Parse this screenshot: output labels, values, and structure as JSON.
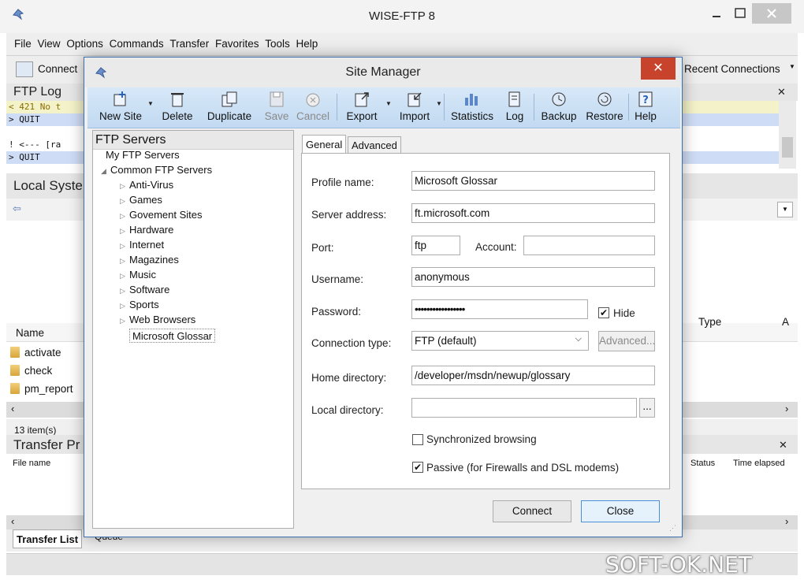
{
  "app": {
    "title": "WISE-FTP 8",
    "menu": [
      "File",
      "View",
      "Options",
      "Commands",
      "Transfer",
      "Favorites",
      "Tools",
      "Help"
    ],
    "connect_label": "Connect",
    "recent_label": "Recent Connections",
    "ftp_log_title": "FTP Log",
    "log_lines": [
      "< 421 No t",
      "> QUIT",
      "",
      "! <--- [ra",
      "> QUIT"
    ],
    "local_system_title": "Local Syste",
    "name_header": "Name",
    "type_header": "Type",
    "a_header": "A",
    "files": [
      "activate",
      "check",
      "pm_report"
    ],
    "items_count": "13 item(s)",
    "transfer_title": "Transfer Pr",
    "file_name_header": "File name",
    "status_header": "Status",
    "time_elapsed_header": "Time elapsed",
    "transfer_tabs": [
      "Transfer List",
      "Queue"
    ],
    "watermark": "SOFT-OK.NET"
  },
  "dialog": {
    "title": "Site Manager",
    "toolbar": [
      {
        "label": "New Site",
        "icon": "new-site-icon"
      },
      {
        "label": "Delete",
        "icon": "trash-icon"
      },
      {
        "label": "Duplicate",
        "icon": "duplicate-icon"
      },
      {
        "label": "Save",
        "icon": "save-icon"
      },
      {
        "label": "Cancel",
        "icon": "cancel-icon"
      },
      {
        "label": "Export",
        "icon": "export-icon"
      },
      {
        "label": "Import",
        "icon": "import-icon"
      },
      {
        "label": "Statistics",
        "icon": "statistics-icon"
      },
      {
        "label": "Log",
        "icon": "log-icon"
      },
      {
        "label": "Backup",
        "icon": "backup-icon"
      },
      {
        "label": "Restore",
        "icon": "restore-icon"
      },
      {
        "label": "Help",
        "icon": "help-icon"
      }
    ],
    "tree_title": "FTP Servers",
    "tree": {
      "my_servers": "My FTP Servers",
      "common_servers": "Common FTP Servers",
      "categories": [
        "Anti-Virus",
        "Games",
        "Govement Sites",
        "Hardware",
        "Internet",
        "Magazines",
        "Music",
        "Software",
        "Sports",
        "Web Browsers"
      ],
      "selected": "Microsoft Glossar"
    },
    "tabs": [
      "General",
      "Advanced"
    ],
    "form": {
      "profile_name_label": "Profile name:",
      "profile_name": "Microsoft Glossar",
      "server_address_label": "Server address:",
      "server_address": "ft.microsoft.com",
      "port_label": "Port:",
      "port": "ftp",
      "account_label": "Account:",
      "account": "",
      "username_label": "Username:",
      "username": "anonymous",
      "password_label": "Password:",
      "password": "•••••••••••••••••",
      "hide_label": "Hide",
      "hide_checked": true,
      "connection_type_label": "Connection type:",
      "connection_type": "FTP (default)",
      "advanced_button": "Advanced...",
      "home_dir_label": "Home directory:",
      "home_dir": "/developer/msdn/newup/glossary",
      "local_dir_label": "Local directory:",
      "local_dir": "",
      "browse_button": "...",
      "sync_label": "Synchronized browsing",
      "sync_checked": false,
      "passive_label": "Passive (for Firewalls and DSL modems)",
      "passive_checked": true
    },
    "connect_button": "Connect",
    "close_button": "Close"
  },
  "colors": {
    "accent": "#3c6fb0",
    "toolbar_bg": "#c8ddf3",
    "close_red": "#c7432b",
    "log_highlight": "#f3f2c8",
    "selection_blue": "#cfdcf5"
  }
}
